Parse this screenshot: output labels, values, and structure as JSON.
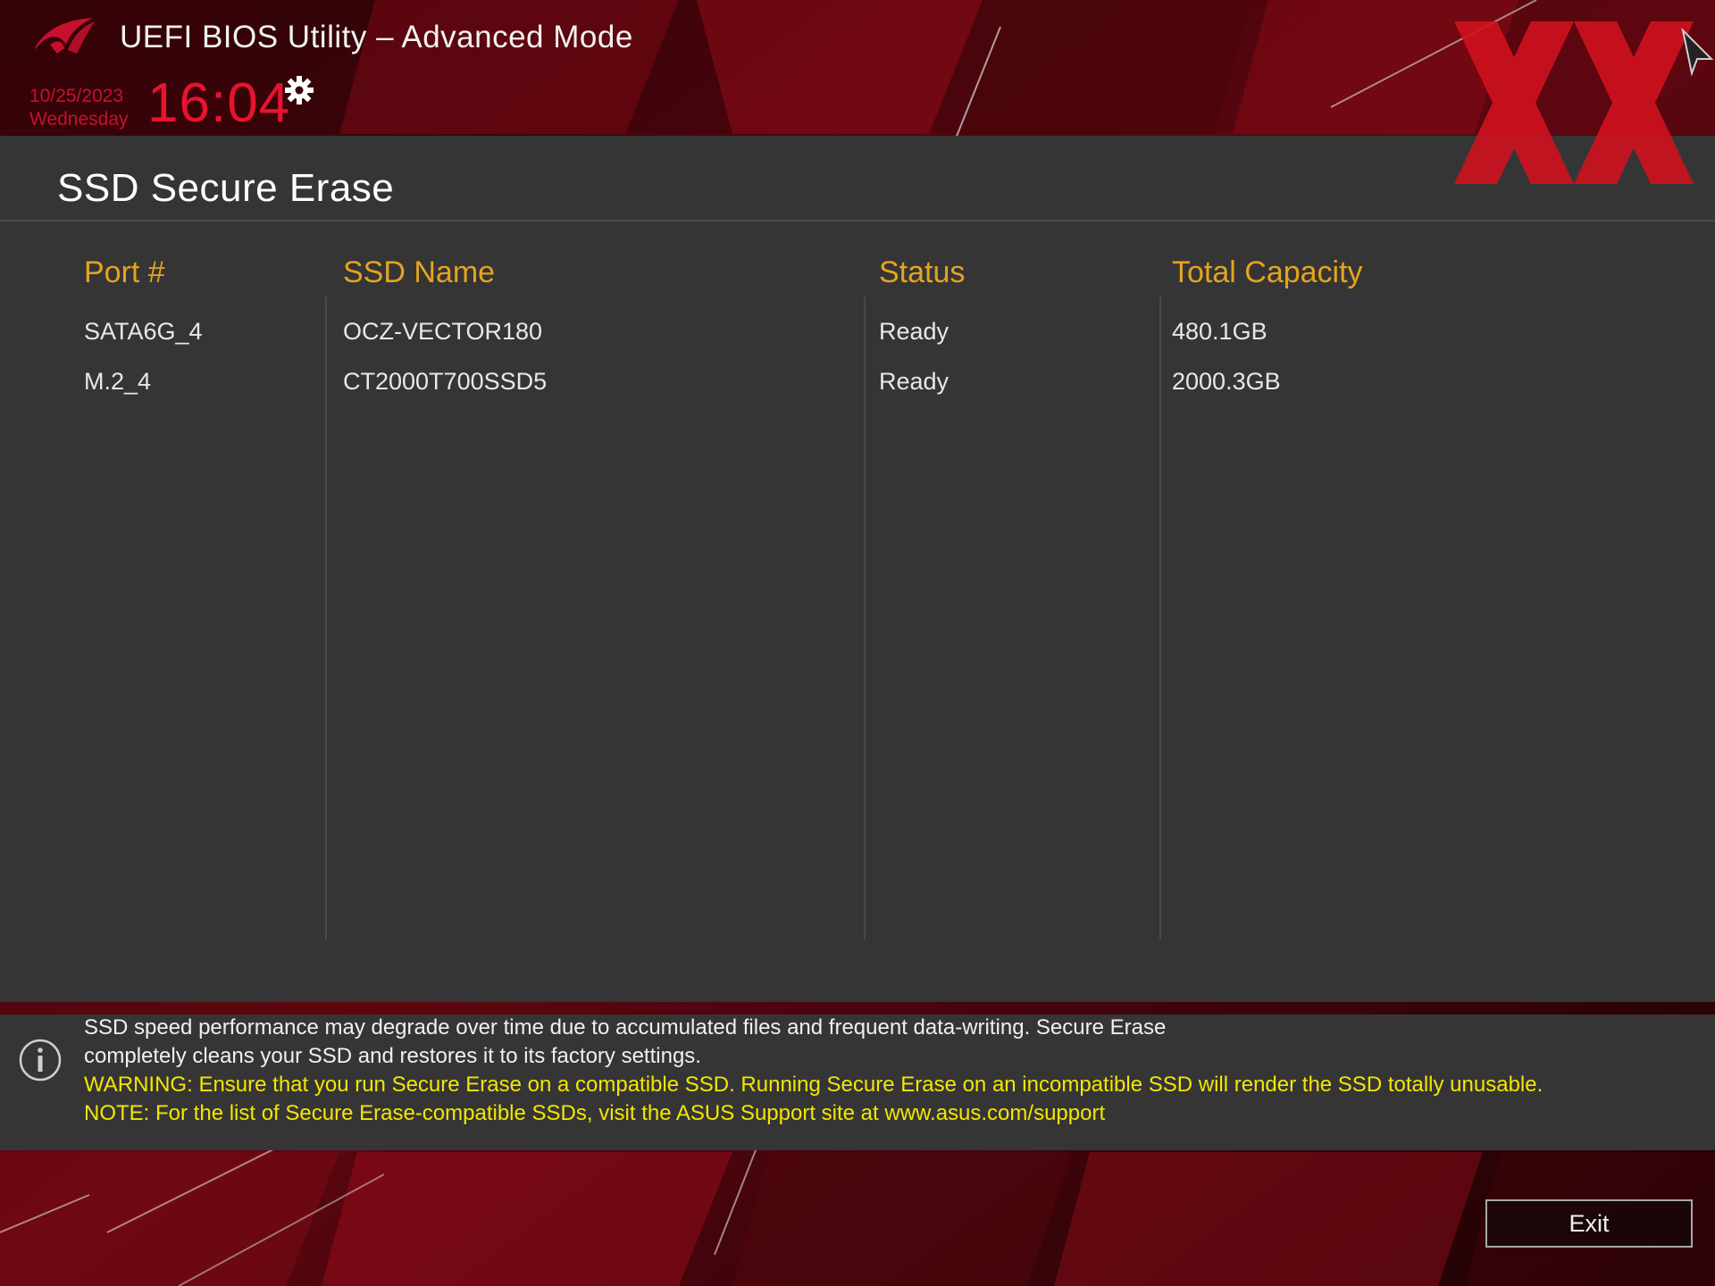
{
  "header": {
    "app_title": "UEFI BIOS Utility – Advanced Mode",
    "date": "10/25/2023",
    "weekday": "Wednesday",
    "time": "16:04"
  },
  "page": {
    "title": "SSD Secure Erase"
  },
  "table": {
    "columns": [
      "Port #",
      "SSD Name",
      "Status",
      "Total Capacity"
    ],
    "rows": [
      {
        "port": "SATA6G_4",
        "name": "OCZ-VECTOR180",
        "status": "Ready",
        "capacity": "480.1GB"
      },
      {
        "port": "M.2_4",
        "name": "CT2000T700SSD5",
        "status": "Ready",
        "capacity": "2000.3GB"
      }
    ]
  },
  "info": {
    "line1": "SSD speed performance may degrade over time due to accumulated files and frequent data-writing. Secure Erase",
    "line2": "completely cleans your SSD and restores it to its factory settings.",
    "warning": "WARNING: Ensure that you run Secure Erase on a compatible SSD. Running Secure Erase on an incompatible SSD will render the SSD totally unusable.",
    "note": "NOTE: For the list of Secure Erase-compatible SSDs, visit the ASUS Support site at www.asus.com/support"
  },
  "footer": {
    "exit_label": "Exit"
  },
  "colors": {
    "accent_red": "#e8132e",
    "header_gold": "#e5a41e",
    "warning_yellow": "#f4e600",
    "panel_gray": "#353536"
  },
  "icons": [
    "rog-logo-icon",
    "gear-icon",
    "info-icon",
    "xx-watermark-icon",
    "mouse-cursor-icon"
  ]
}
